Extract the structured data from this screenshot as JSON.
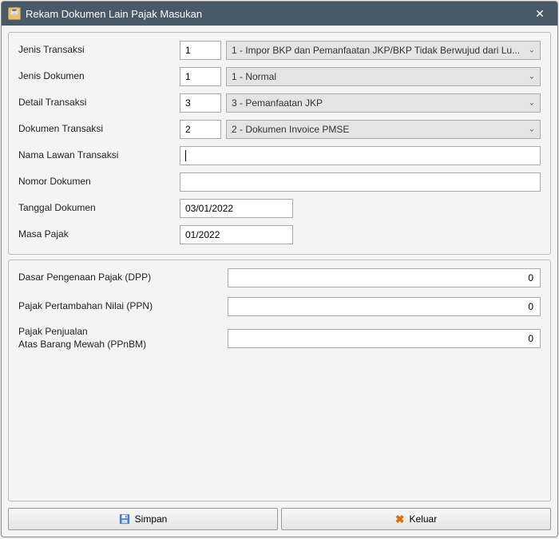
{
  "window": {
    "title": "Rekam Dokumen Lain Pajak Masukan"
  },
  "form": {
    "jenis_transaksi": {
      "label": "Jenis Transaksi",
      "code": "1",
      "text": "1 - Impor BKP dan Pemanfaatan JKP/BKP Tidak Berwujud dari Lu..."
    },
    "jenis_dokumen": {
      "label": "Jenis Dokumen",
      "code": "1",
      "text": "1 - Normal"
    },
    "detail_transaksi": {
      "label": "Detail Transaksi",
      "code": "3",
      "text": "3 - Pemanfaatan JKP"
    },
    "dokumen_transaksi": {
      "label": "Dokumen Transaksi",
      "code": "2",
      "text": "2 - Dokumen Invoice PMSE"
    },
    "nama_lawan": {
      "label": "Nama Lawan Transaksi",
      "value": ""
    },
    "nomor_dokumen": {
      "label": "Nomor Dokumen",
      "value": ""
    },
    "tanggal_dokumen": {
      "label": "Tanggal Dokumen",
      "value": "03/01/2022"
    },
    "masa_pajak": {
      "label": "Masa Pajak",
      "value": "01/2022"
    }
  },
  "amounts": {
    "dpp": {
      "label": "Dasar Pengenaan Pajak (DPP)",
      "value": "0"
    },
    "ppn": {
      "label": "Pajak Pertambahan Nilai (PPN)",
      "value": "0"
    },
    "ppnbm": {
      "label_line1": "Pajak Penjualan",
      "label_line2": "Atas Barang Mewah (PPnBM)",
      "value": "0"
    }
  },
  "buttons": {
    "simpan": "Simpan",
    "keluar": "Keluar"
  }
}
